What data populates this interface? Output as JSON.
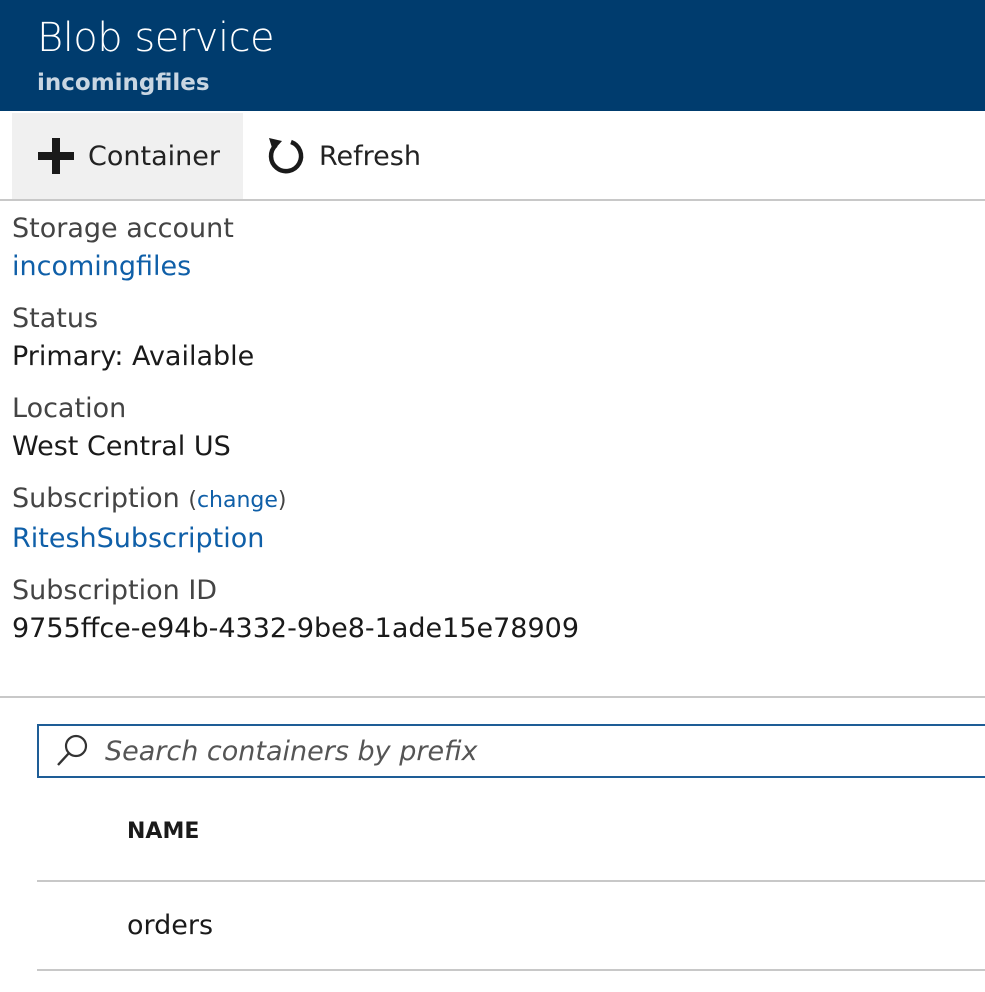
{
  "header": {
    "title": "Blob service",
    "subtitle": "incomingfiles"
  },
  "toolbar": {
    "container_label": "Container",
    "container_icon": "plus-icon",
    "refresh_label": "Refresh",
    "refresh_icon": "refresh-icon"
  },
  "details": {
    "storage_account_label": "Storage account",
    "storage_account_value": "incomingfiles",
    "status_label": "Status",
    "status_value": "Primary: Available",
    "location_label": "Location",
    "location_value": "West Central US",
    "subscription_label": "Subscription",
    "subscription_change": "change",
    "subscription_value": "RiteshSubscription",
    "subscription_id_label": "Subscription ID",
    "subscription_id_value": "9755ffce-e94b-4332-9be8-1ade15e78909"
  },
  "search": {
    "placeholder": "Search containers by prefix",
    "value": "",
    "icon": "search-icon"
  },
  "table": {
    "columns": [
      "NAME"
    ],
    "rows": [
      {
        "name": "orders"
      }
    ]
  },
  "colors": {
    "header_bg": "#003c6e",
    "link": "#0f5fa8",
    "search_border": "#1e5d96"
  }
}
